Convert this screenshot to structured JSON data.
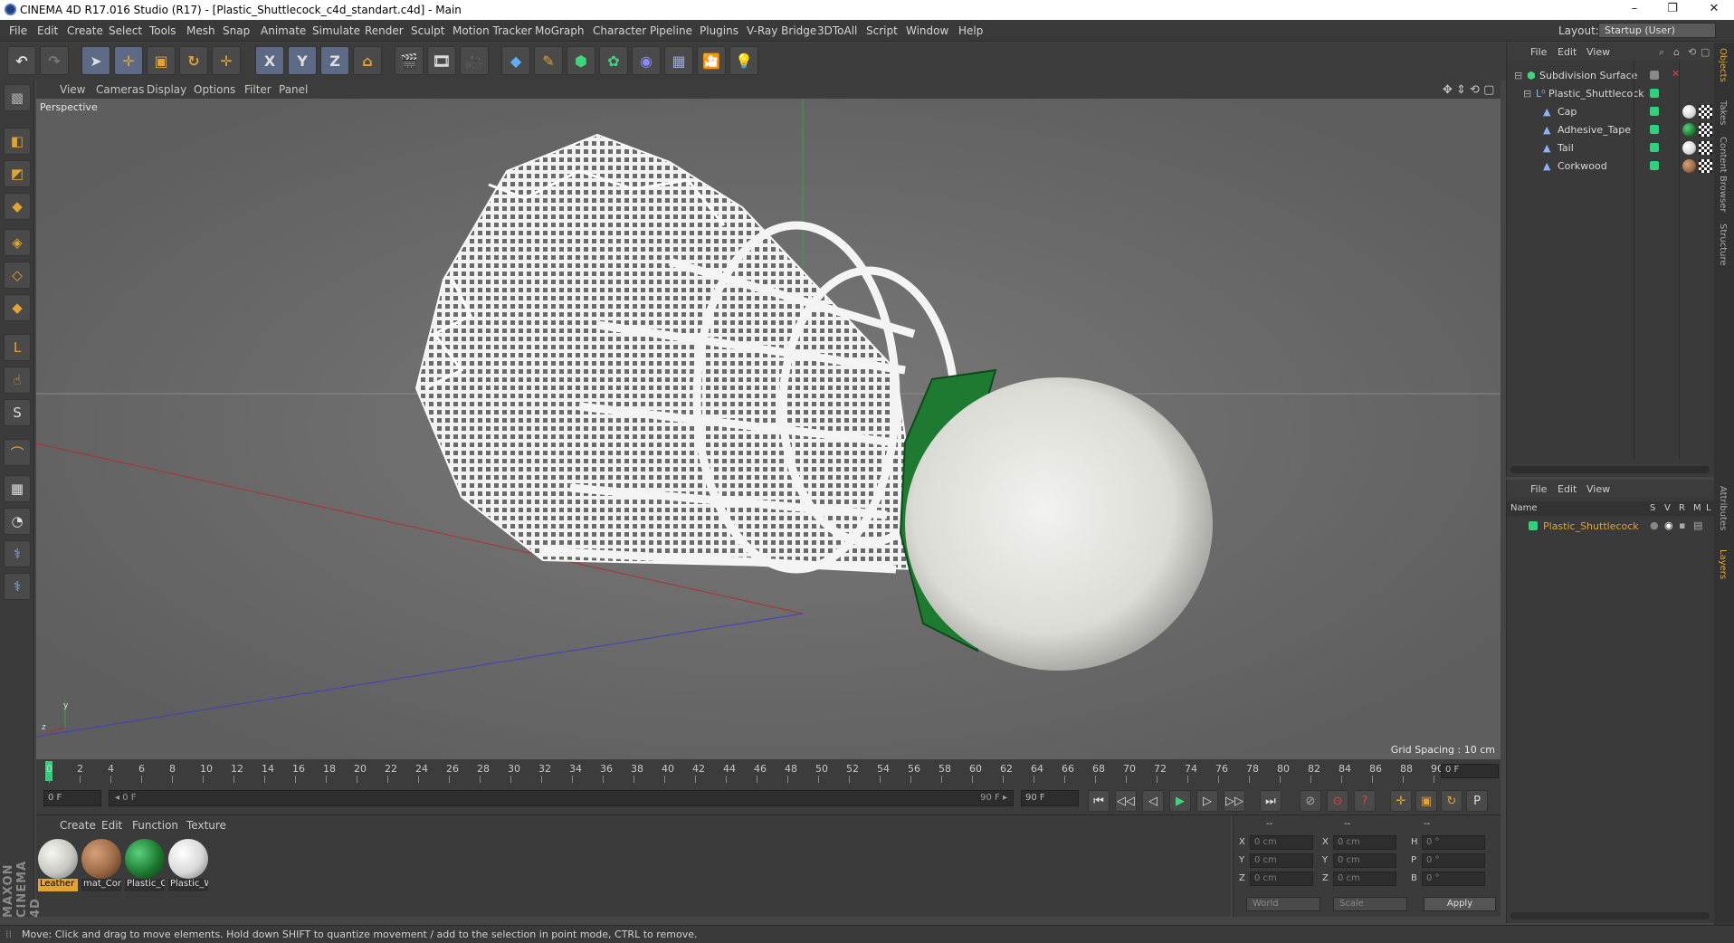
{
  "window": {
    "title": "CINEMA 4D R17.016 Studio (R17) - [Plastic_Shuttlecock_c4d_standart.c4d] - Main",
    "min_glyph": "–",
    "restore_glyph": "❐",
    "close_glyph": "✕"
  },
  "menubar": {
    "items": [
      "File",
      "Edit",
      "Create",
      "Select",
      "Tools",
      "Mesh",
      "Snap",
      "Animate",
      "Simulate",
      "Render",
      "Sculpt",
      "Motion Tracker",
      "MoGraph",
      "Character",
      "Pipeline",
      "Plugins",
      "V-Ray Bridge",
      "3DToAll",
      "Script",
      "Window",
      "Help"
    ],
    "layout_label": "Layout:",
    "layout_value": "Startup (User)"
  },
  "toolbar": {
    "undo_icon": "↶",
    "redo_icon": "↷",
    "select_icon": "➤",
    "move_icon": "✛",
    "scale_icon": "▣",
    "rotate_icon": "↻",
    "x_axis": "X",
    "y_axis": "Y",
    "z_axis": "Z",
    "coord_icon": "⌂",
    "render_icons": [
      "🎬",
      "🎞",
      "🎥"
    ],
    "object_icons": [
      "◆",
      "✎",
      "⬢",
      "✿",
      "◉",
      "▦",
      "🎦",
      "💡"
    ]
  },
  "lefttools": {
    "icons": [
      "▩",
      "◧",
      "◩",
      "◆",
      "◈",
      "◇",
      "◆",
      "L",
      "☝",
      "S",
      "⌒",
      "▦",
      "◔",
      "⚕",
      "⚕"
    ]
  },
  "viewport": {
    "menu": [
      "View",
      "Cameras",
      "Display",
      "Options",
      "Filter",
      "Panel"
    ],
    "label": "Perspective",
    "grid_spacing": "Grid Spacing : 10 cm",
    "axis_y": "y",
    "axis_z": "z"
  },
  "timeline": {
    "ticks": [
      "0",
      "2",
      "4",
      "6",
      "8",
      "10",
      "12",
      "14",
      "16",
      "18",
      "20",
      "22",
      "24",
      "26",
      "28",
      "30",
      "32",
      "34",
      "36",
      "38",
      "40",
      "42",
      "44",
      "46",
      "48",
      "50",
      "52",
      "54",
      "56",
      "58",
      "60",
      "62",
      "64",
      "66",
      "68",
      "70",
      "72",
      "74",
      "76",
      "78",
      "80",
      "82",
      "84",
      "86",
      "88",
      "90"
    ],
    "end_frame": "0 F",
    "current_frame": 0,
    "max_frame": 90
  },
  "playbar": {
    "start_field": "0 F",
    "range_start": "◂ 0 F",
    "range_end": "90 F ▸",
    "end_field": "90 F",
    "buttons": [
      "⏮",
      "◁◁",
      "◁",
      "▶",
      "▷",
      "▷▷",
      "⏭"
    ],
    "key_icons": [
      "⊘",
      "⊙",
      "?",
      "✛",
      "▣",
      "↻",
      "P",
      "▦",
      "▤"
    ]
  },
  "materials": {
    "menu": [
      "Create",
      "Edit",
      "Function",
      "Texture"
    ],
    "items": [
      {
        "name": "Leather",
        "color": "#c8c8c2",
        "selected": true
      },
      {
        "name": "mat_Cor",
        "color": "#9a6a45",
        "selected": false
      },
      {
        "name": "Plastic_G",
        "color": "#1e7a30",
        "selected": false
      },
      {
        "name": "Plastic_W",
        "color": "#d8d8d8",
        "selected": false
      }
    ]
  },
  "coordinates": {
    "header": [
      "--",
      "--",
      "--"
    ],
    "rows": [
      {
        "l1": "X",
        "v1": "0 cm",
        "l2": "X",
        "v2": "0 cm",
        "l3": "H",
        "v3": "0 °"
      },
      {
        "l1": "Y",
        "v1": "0 cm",
        "l2": "Y",
        "v2": "0 cm",
        "l3": "P",
        "v3": "0 °"
      },
      {
        "l1": "Z",
        "v1": "0 cm",
        "l2": "Z",
        "v2": "0 cm",
        "l3": "B",
        "v3": "0 °"
      }
    ],
    "world": "World",
    "scale": "Scale",
    "apply": "Apply"
  },
  "objects": {
    "menu": [
      "File",
      "Edit",
      "View"
    ],
    "tree": [
      {
        "name": "Subdivision Surface",
        "indent": 0,
        "color": "#2ed27a"
      },
      {
        "name": "Plastic_Shuttlecock",
        "indent": 1,
        "color": "#2ed27a"
      },
      {
        "name": "Cap",
        "indent": 2,
        "color": "#2ed27a",
        "tag": "#d8d8d8"
      },
      {
        "name": "Adhesive_Tape",
        "indent": 2,
        "color": "#2ed27a",
        "tag": "#1e7a30"
      },
      {
        "name": "Tail",
        "indent": 2,
        "color": "#2ed27a",
        "tag": "#d8d8d8"
      },
      {
        "name": "Corkwood",
        "indent": 2,
        "color": "#2ed27a",
        "tag": "#9a6a45"
      }
    ]
  },
  "layers": {
    "menu": [
      "File",
      "Edit",
      "View"
    ],
    "columns": [
      "Name",
      "S",
      "V",
      "R",
      "M",
      "L"
    ],
    "rows": [
      {
        "name": "Plastic_Shuttlecock",
        "color": "#e2a332"
      }
    ]
  },
  "sidetabs": [
    "Objects",
    "Takes",
    "Content Browser",
    "Structure",
    "Attributes",
    "Layers"
  ],
  "status": {
    "text": "Move: Click and drag to move elements. Hold down SHIFT to quantize movement / add to the selection in point mode, CTRL to remove."
  },
  "branding": {
    "logo": "MAXON CINEMA 4D"
  }
}
